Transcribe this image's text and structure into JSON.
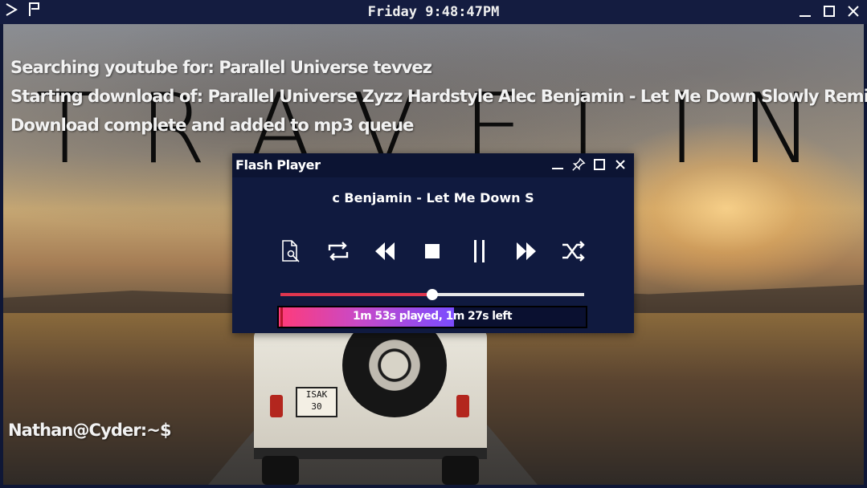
{
  "topbar": {
    "clock": "Friday 9:48:47PM",
    "icons": [
      "terminal-icon",
      "flag-icon"
    ],
    "window_controls": [
      "minimize-icon",
      "maximize-icon",
      "close-icon"
    ]
  },
  "wallpaper": {
    "title": "TRAVELING",
    "plate_line1": "ISAK",
    "plate_line2": "30"
  },
  "terminal": {
    "lines": [
      "Searching youtube for: Parallel Universe tevvez",
      "Starting download of: Parallel Universe Zyzz Hardstyle Alec Benjamin - Let Me Down Slowly Remix",
      "Download complete and added to mp3 queue"
    ],
    "prompt": "Nathan@Cyder:~$"
  },
  "player": {
    "title": "Flash Player",
    "title_controls": [
      "minimize-icon",
      "pin-icon",
      "maximize-icon",
      "close-icon"
    ],
    "now_playing": "c Benjamin - Let Me Down S",
    "controls": [
      "open-file-icon",
      "repeat-icon",
      "rewind-icon",
      "stop-icon",
      "pause-icon",
      "fast-forward-icon",
      "shuffle-icon"
    ],
    "seek_fraction": 0.5,
    "progress_fraction": 0.57,
    "progress_label": "1m 53s played, 1m 27s left",
    "colors": {
      "background": "#101a3f",
      "progress_start": "#ff3b79",
      "progress_end": "#7b4cff",
      "seek_fill": "#e0364f"
    }
  }
}
